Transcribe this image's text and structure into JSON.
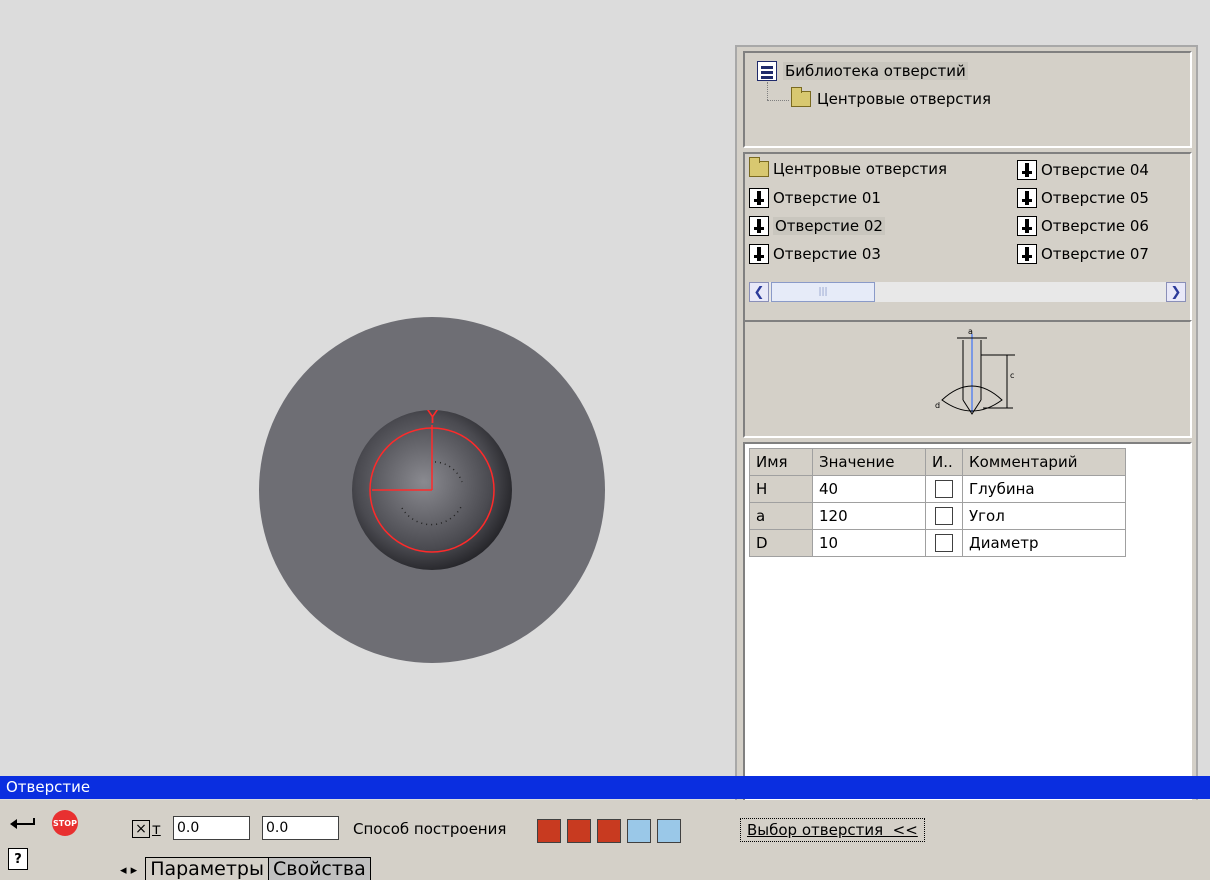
{
  "tree": {
    "root_label": "Библиотека отверстий",
    "child_label": "Центровые отверстия"
  },
  "list": {
    "items_left": [
      "Центровые отверстия",
      "Отверстие 01",
      "Отверстие 02",
      "Отверстие 03"
    ],
    "items_right": [
      "Отверстие 04",
      "Отверстие 05",
      "Отверстие 06",
      "Отверстие 07"
    ],
    "selected": "Отверстие 02"
  },
  "params": {
    "headers": [
      "Имя",
      "Значение",
      "И..",
      "Комментарий"
    ],
    "rows": [
      {
        "name": "H",
        "value": "40",
        "comment": "Глубина"
      },
      {
        "name": "a",
        "value": "120",
        "comment": "Угол"
      },
      {
        "name": "D",
        "value": "10",
        "comment": "Диаметр"
      }
    ]
  },
  "viewport": {
    "axis_label": "Y"
  },
  "preview": {
    "label_a": "a",
    "label_c": "c",
    "label_d": "d"
  },
  "titlebar": {
    "title": "Отверстие"
  },
  "toolbar": {
    "coord_label": "т",
    "x_value": "0.0",
    "y_value": "0.0",
    "method_label": "Способ построения",
    "select_hole_button": "Выбор отверстия  <<"
  },
  "tabs": {
    "arrows": "◂ ▸",
    "params": "Параметры",
    "props": "Свойства"
  },
  "colors": {
    "title_bar": "#0a2ee0",
    "disk_outer": "#6e6e74",
    "red_line": "#ff2a2a"
  }
}
